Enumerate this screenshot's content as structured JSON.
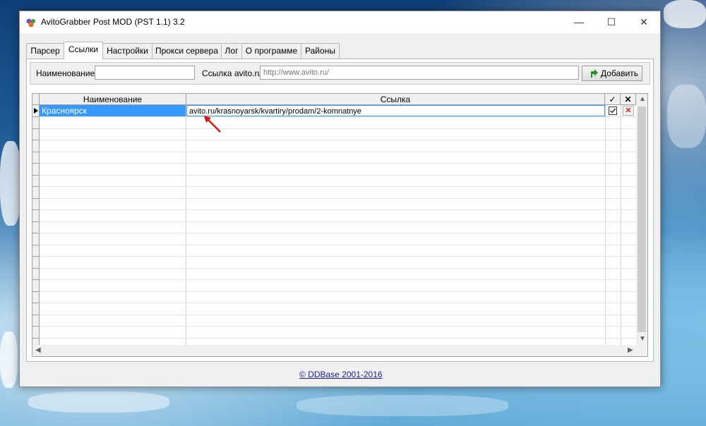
{
  "window": {
    "title": "AvitoGrabber Post MOD (PST 1.1) 3.2",
    "controls": {
      "minimize": "—",
      "maximize": "☐",
      "close": "✕"
    }
  },
  "tabs": [
    {
      "label": "Парсер",
      "active": false
    },
    {
      "label": "Ссылки",
      "active": true
    },
    {
      "label": "Настройки",
      "active": false
    },
    {
      "label": "Прокси сервера",
      "active": false
    },
    {
      "label": "Лог",
      "active": false
    },
    {
      "label": "О программе",
      "active": false
    },
    {
      "label": "Районы",
      "active": false
    }
  ],
  "form": {
    "name_label": "Наименование",
    "name_value": "",
    "url_label": "Ссылка avito.ru",
    "url_placeholder": "http://www.avito.ru/",
    "add_button": "Добавить"
  },
  "grid": {
    "columns": {
      "name": "Наименование",
      "link": "Ссылка",
      "enabled": "✓",
      "delete": "✕"
    },
    "rows": [
      {
        "name": "Красноярск",
        "link": "avito.ru/krasnoyarsk/kvartiry/prodam/2-komnatnye",
        "enabled": true,
        "delete": "✕"
      }
    ]
  },
  "footer": {
    "copyright_link": "© DDBase 2001-2016"
  },
  "colors": {
    "selection": "#3399ff",
    "link": "#1a1aa0",
    "delete": "#e02020",
    "annotation_arrow": "#e01010"
  },
  "icons": [
    "app-icon",
    "add-arrow-icon",
    "row-pointer-icon",
    "checkbox-icon",
    "delete-icon",
    "scroll-up-icon",
    "scroll-down-icon",
    "scroll-left-icon",
    "scroll-right-icon",
    "annotation-arrow"
  ]
}
